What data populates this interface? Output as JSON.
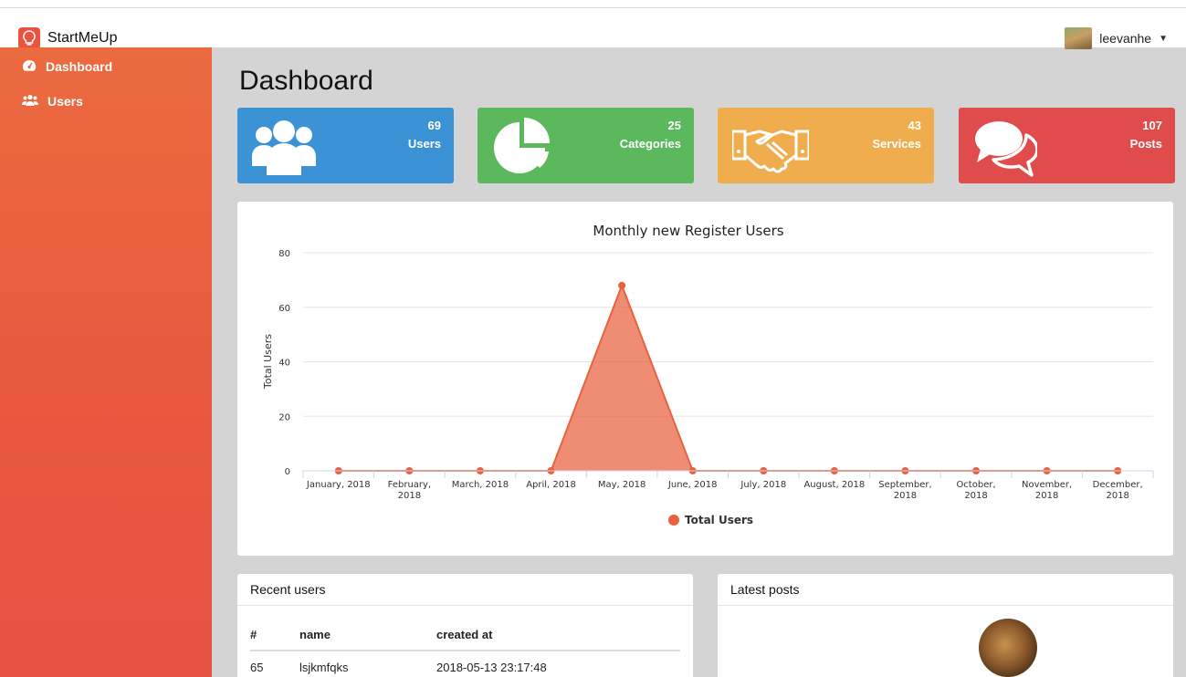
{
  "app": {
    "name": "StartMeUp"
  },
  "user_menu": {
    "username": "leevanhe"
  },
  "sidebar": {
    "items": [
      {
        "label": "Dashboard",
        "icon": "dashboard-icon"
      },
      {
        "label": "Users",
        "icon": "users-icon"
      }
    ]
  },
  "page": {
    "title": "Dashboard"
  },
  "stats": [
    {
      "value": "69",
      "label": "Users",
      "icon": "users-group-icon",
      "color": "#3b93d6"
    },
    {
      "value": "25",
      "label": "Categories",
      "icon": "pie-chart-icon",
      "color": "#5cb85c"
    },
    {
      "value": "43",
      "label": "Services",
      "icon": "handshake-icon",
      "color": "#f0ad4e"
    },
    {
      "value": "107",
      "label": "Posts",
      "icon": "comments-icon",
      "color": "#e04c4c"
    }
  ],
  "chart_data": {
    "type": "area",
    "title": "Monthly new Register Users",
    "ylabel": "Total Users",
    "xlabel": "",
    "ylim": [
      0,
      80
    ],
    "yticks": [
      0,
      20,
      40,
      60,
      80
    ],
    "categories": [
      [
        "January, 2018"
      ],
      [
        "February,",
        "2018"
      ],
      [
        "March, 2018"
      ],
      [
        "April, 2018"
      ],
      [
        "May, 2018"
      ],
      [
        "June, 2018"
      ],
      [
        "July, 2018"
      ],
      [
        "August, 2018"
      ],
      [
        "September,",
        "2018"
      ],
      [
        "October,",
        "2018"
      ],
      [
        "November,",
        "2018"
      ],
      [
        "December,",
        "2018"
      ]
    ],
    "series": [
      {
        "name": "Total Users",
        "values": [
          0,
          0,
          0,
          0,
          68,
          0,
          0,
          0,
          0,
          0,
          0,
          0
        ]
      }
    ],
    "color": "#e9613f",
    "legend": "bottom",
    "grid": true
  },
  "recent_users": {
    "title": "Recent users",
    "columns": [
      "#",
      "name",
      "created at"
    ],
    "rows": [
      {
        "id": "65",
        "name": "lsjkmfqks",
        "created_at": "2018-05-13 23:17:48"
      }
    ]
  },
  "latest_posts": {
    "title": "Latest posts"
  }
}
